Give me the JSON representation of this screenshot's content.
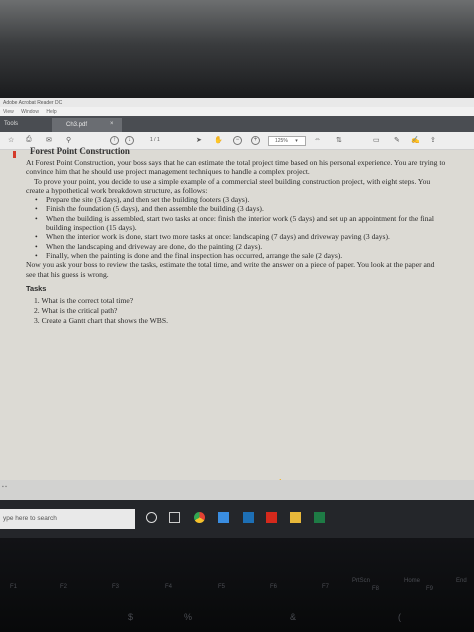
{
  "app": {
    "window_title": "Adobe Acrobat Reader DC",
    "menu": [
      "View",
      "Window",
      "Help"
    ],
    "tab_home": "Tools",
    "tab_document": "Ch3.pdf",
    "tab_close": "×"
  },
  "toolbar": {
    "page_indicator": "1 / 1",
    "zoom": "125%"
  },
  "document": {
    "heading": "Forest Point Construction",
    "para1": "At Forest Point Construction, your boss says that he can estimate the total project time based on his personal experience. You are trying to convince him that he should use project management techniques to handle a complex project.",
    "para2": "To prove your point, you decide to use a simple example of a commercial steel building construction project, with eight steps. You create a hypothetical work breakdown structure, as follows:",
    "bullets": [
      "Prepare the site (3 days), and then set the building footers (3  days).",
      "Finish the foundation (5 days), and then assemble the building (3 days).",
      "When the building is assembled, start two tasks at once: finish the interior work (5 days) and set up an appointment for the final building inspection (15 days).",
      "When the interior work is done, start two more tasks at once: landscaping (7 days) and driveway paving (3 days).",
      "When the landscaping and driveway are done, do the painting (2 days).",
      "Finally, when the painting is done and the final inspection has occurred, arrange the sale (2 days)."
    ],
    "para3": "Now you ask your boss to review the tasks, estimate the total time, and write the answer on a piece of paper. You look at the paper and see that his guess is   wrong.",
    "tasks_heading": "Tasks",
    "tasks": [
      "1. What is the correct total time?",
      "2. What is the critical path?",
      "3. Create a Gantt chart that shows the WBS."
    ]
  },
  "taskbar": {
    "search_placeholder": "ype here to search"
  },
  "keyboard": {
    "keys": [
      "F1",
      "F2",
      "F3",
      "F4",
      "F5",
      "F6",
      "F7",
      "PrtScn",
      "F8",
      "Home",
      "F9",
      "End",
      "$",
      "%",
      "&",
      "("
    ]
  }
}
